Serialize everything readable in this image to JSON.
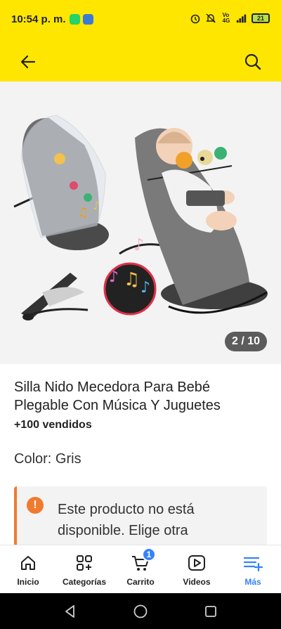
{
  "status": {
    "time": "10:54 p. m.",
    "battery": "21",
    "icons": [
      "whatsapp-icon",
      "app-icon",
      "alarm-icon",
      "mute-icon",
      "volte-icon",
      "signal-icon",
      "battery-icon"
    ]
  },
  "header": {
    "back_icon": "arrow-left-icon",
    "search_icon": "search-icon",
    "background": "#ffe600"
  },
  "gallery": {
    "counter": "2 / 10"
  },
  "product": {
    "title": "Silla Nido Mecedora Para Bebé Plegable Con Música Y Juguetes",
    "sold": "+100 vendidos",
    "color": "Color: Gris"
  },
  "notice": {
    "icon": "!",
    "text": "Este producto no está disponible. Elige otra",
    "accent": "#f07b30"
  },
  "bottom_nav": {
    "items": [
      {
        "label": "Inicio",
        "icon": "home-icon"
      },
      {
        "label": "Categorías",
        "icon": "categories-icon"
      },
      {
        "label": "Carrito",
        "icon": "cart-icon",
        "badge": "1"
      },
      {
        "label": "Videos",
        "icon": "video-icon"
      },
      {
        "label": "Más",
        "icon": "more-icon"
      }
    ],
    "active_color": "#3483fa"
  }
}
